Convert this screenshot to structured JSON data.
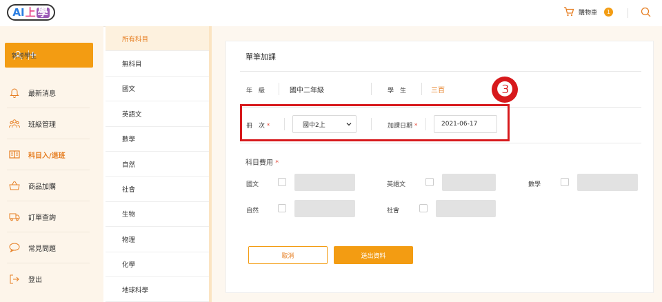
{
  "header": {
    "logo": {
      "part1": "AI",
      "part2": "上",
      "part3": "學"
    },
    "cart_label": "購物車",
    "cart_count": "1"
  },
  "sidebar": {
    "add_student_label": "新增學生",
    "add_icon": "+",
    "items": [
      {
        "label": "最新消息",
        "icon": "bell-icon"
      },
      {
        "label": "班級管理",
        "icon": "group-icon"
      },
      {
        "label": "科目入/退班",
        "icon": "book-icon",
        "active": true
      },
      {
        "label": "商品加購",
        "icon": "basket-icon"
      },
      {
        "label": "訂單查詢",
        "icon": "truck-icon"
      },
      {
        "label": "常見問題",
        "icon": "chat-icon"
      },
      {
        "label": "登出",
        "icon": "logout-icon"
      }
    ]
  },
  "subjects": [
    "所有科目",
    "無科目",
    "國文",
    "英語文",
    "數學",
    "自然",
    "社會",
    "生物",
    "物理",
    "化學",
    "地球科學"
  ],
  "form": {
    "title": "單筆加課",
    "grade_label": "年　級",
    "grade_value": "國中二年級",
    "student_label": "學　生",
    "student_value": "三百",
    "volume_label": "冊　次",
    "volume_value": "國中2上",
    "date_label": "加課日期",
    "date_value": "2021-06-17",
    "required_mark": "*",
    "step_number": "❸",
    "fees_label": "科目費用",
    "fees": [
      {
        "label": "國文"
      },
      {
        "label": "英語文"
      },
      {
        "label": "數學"
      },
      {
        "label": "自然"
      },
      {
        "label": "社會"
      }
    ],
    "cancel_label": "取消",
    "submit_label": "送出資料"
  },
  "colors": {
    "accent": "#f39c12",
    "highlight": "#d7191c"
  }
}
